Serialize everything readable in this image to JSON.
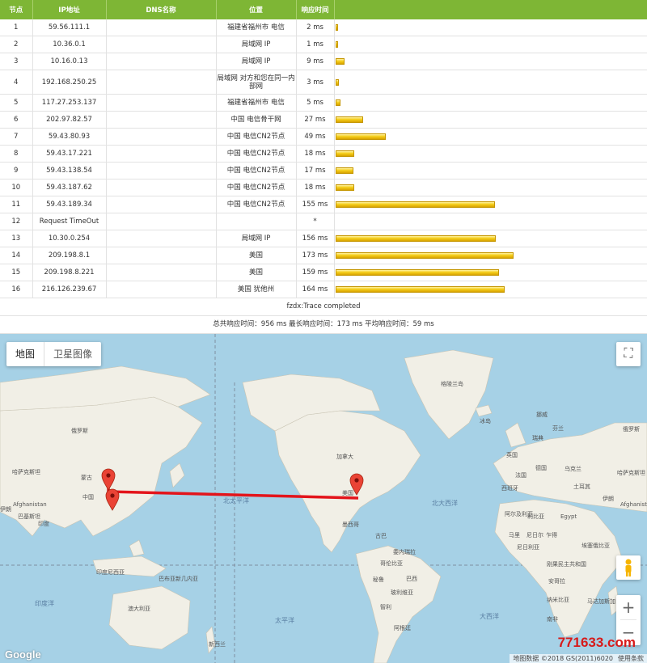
{
  "columns": [
    "节点",
    "IP地址",
    "DNS名称",
    "位置",
    "响应时间"
  ],
  "hops": [
    {
      "n": "1",
      "ip": "59.56.111.1",
      "dns": "",
      "loc": "福建省福州市 电信",
      "time": "2 ms",
      "ms": 2
    },
    {
      "n": "2",
      "ip": "10.36.0.1",
      "dns": "",
      "loc": "局域网 IP",
      "time": "1 ms",
      "ms": 1
    },
    {
      "n": "3",
      "ip": "10.16.0.13",
      "dns": "",
      "loc": "局域网 IP",
      "time": "9 ms",
      "ms": 9
    },
    {
      "n": "4",
      "ip": "192.168.250.25",
      "dns": "",
      "loc": "局域网 对方和您在同一内部网",
      "time": "3 ms",
      "ms": 3
    },
    {
      "n": "5",
      "ip": "117.27.253.137",
      "dns": "",
      "loc": "福建省福州市 电信",
      "time": "5 ms",
      "ms": 5
    },
    {
      "n": "6",
      "ip": "202.97.82.57",
      "dns": "",
      "loc": "中国 电信骨干网",
      "time": "27 ms",
      "ms": 27
    },
    {
      "n": "7",
      "ip": "59.43.80.93",
      "dns": "",
      "loc": "中国 电信CN2节点",
      "time": "49 ms",
      "ms": 49
    },
    {
      "n": "8",
      "ip": "59.43.17.221",
      "dns": "",
      "loc": "中国 电信CN2节点",
      "time": "18 ms",
      "ms": 18
    },
    {
      "n": "9",
      "ip": "59.43.138.54",
      "dns": "",
      "loc": "中国 电信CN2节点",
      "time": "17 ms",
      "ms": 17
    },
    {
      "n": "10",
      "ip": "59.43.187.62",
      "dns": "",
      "loc": "中国 电信CN2节点",
      "time": "18 ms",
      "ms": 18
    },
    {
      "n": "11",
      "ip": "59.43.189.34",
      "dns": "",
      "loc": "中国 电信CN2节点",
      "time": "155 ms",
      "ms": 155
    },
    {
      "n": "12",
      "ip": "Request TimeOut",
      "dns": "",
      "loc": "",
      "time": "*",
      "ms": 0
    },
    {
      "n": "13",
      "ip": "10.30.0.254",
      "dns": "",
      "loc": "局域网 IP",
      "time": "156 ms",
      "ms": 156
    },
    {
      "n": "14",
      "ip": "209.198.8.1",
      "dns": "",
      "loc": "美国",
      "time": "173 ms",
      "ms": 173
    },
    {
      "n": "15",
      "ip": "209.198.8.221",
      "dns": "",
      "loc": "美国",
      "time": "159 ms",
      "ms": 159
    },
    {
      "n": "16",
      "ip": "216.126.239.67",
      "dns": "",
      "loc": "美国 犹他州",
      "time": "164 ms",
      "ms": 164
    }
  ],
  "status": "fzdx:Trace completed",
  "summary": "总共响应时间：956 ms    最长响应时间：173 ms    平均响应时间：59 ms",
  "map": {
    "tab_map": "地图",
    "tab_satellite": "卫星图像",
    "labels": {
      "greenland": "格陵兰岛",
      "iceland": "冰岛",
      "canada": "加拿大",
      "usa": "美国",
      "mexico": "墨西哥",
      "n_pacific": "北太平洋",
      "n_atlantic": "北大西洋",
      "s_pacific": "太平洋",
      "s_atlantic": "大西洋",
      "indian": "印度洋",
      "china": "中国",
      "mongolia": "蒙古",
      "kazakhstan": "哈萨克斯坦",
      "afghanistan": "Afghanistan",
      "iran": "伊朗",
      "india": "印度",
      "pakistan": "巴基斯坦",
      "indonesia": "印度尼西亚",
      "australia": "澳大利亚",
      "russia": "俄罗斯",
      "egypt": "Egypt",
      "algeria": "阿尔及利亚",
      "libya": "利比亚",
      "mali": "马里",
      "niger": "尼日尔",
      "chad": "乍得",
      "nigeria": "尼日利亚",
      "ethiopia": "埃塞俄比亚",
      "drc": "刚果民主共和国",
      "angola": "安哥拉",
      "namibia": "纳米比亚",
      "south_africa": "南非",
      "madagascar": "马达加斯加",
      "brazil": "巴西",
      "peru": "秘鲁",
      "bolivia": "玻利维亚",
      "colombia": "哥伦比亚",
      "venezuela": "委内瑞拉",
      "argentina": "阿根廷",
      "chile": "智利",
      "cuba": "古巴",
      "ukraine": "乌克兰",
      "france": "法国",
      "spain": "西班牙",
      "germany": "德国",
      "sweden": "瑞典",
      "finland": "芬兰",
      "norway": "挪威",
      "uk": "英国",
      "turkey": "土耳其",
      "iran_r": "伊朗",
      "iran_p": "伊朗",
      "kazakh_r": "哈萨克斯坦",
      "afghan_r": "Afghanistan",
      "mongolia2": "蒙古",
      "russia2": "俄罗斯",
      "png": "巴布亚新几内亚",
      "nz": "新西兰",
      "venezuela2": "委内瑞拉"
    },
    "logo": "Google",
    "attribution": "地图数据 ©2018 GS(2011)6020",
    "terms": "使用条款",
    "zoom_in": "+",
    "zoom_out": "−",
    "fullscreen": "⛶"
  },
  "watermark": "771633.com",
  "colors": {
    "header": "#7eb635",
    "route": "#e3141b",
    "water": "#a6d1e6",
    "land": "#f1efe6",
    "marker": "#ea4335"
  }
}
